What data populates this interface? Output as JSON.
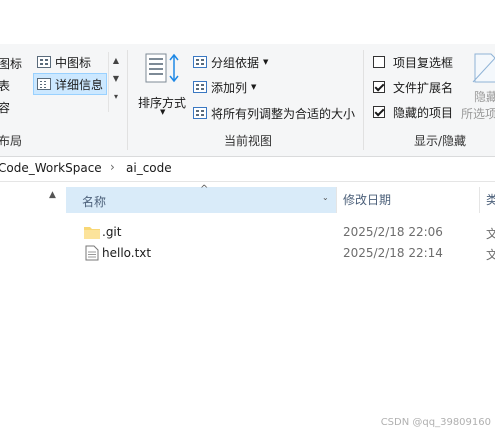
{
  "ribbon": {
    "layout_group": {
      "items": [
        {
          "label": "图标",
          "icon": "icon-grid-icon"
        },
        {
          "label": "表",
          "icon": ""
        },
        {
          "label": "容",
          "icon": ""
        },
        {
          "label": "中图标",
          "icon": "medium-icons-icon"
        },
        {
          "label": "详细信息",
          "icon": "details-icon",
          "selected": true
        }
      ],
      "label": "布局"
    },
    "current_view_group": {
      "sort_label": "排序方式",
      "group_by_label": "分组依据",
      "add_column_label": "添加列",
      "fit_columns_label": "将所有列调整为合适的大小",
      "label": "当前视图"
    },
    "show_hide_group": {
      "checkboxes": [
        {
          "label": "项目复选框",
          "checked": false
        },
        {
          "label": "文件扩展名",
          "checked": true
        },
        {
          "label": "隐藏的项目",
          "checked": true
        }
      ],
      "hide_label": "隐藏",
      "hide_selected_label": "所选项",
      "label": "显示/隐藏"
    }
  },
  "address": {
    "segments": [
      "Code_WorkSpace",
      "ai_code"
    ],
    "separator": "›"
  },
  "list": {
    "columns": {
      "name": "名称",
      "date": "修改日期",
      "type": "类"
    },
    "rows": [
      {
        "name": ".git",
        "date": "2025/2/18 22:06",
        "type": "文",
        "icon": "folder-icon"
      },
      {
        "name": "hello.txt",
        "date": "2025/2/18 22:14",
        "type": "文",
        "icon": "text-file-icon"
      }
    ]
  },
  "watermark": "CSDN @qq_39809160"
}
